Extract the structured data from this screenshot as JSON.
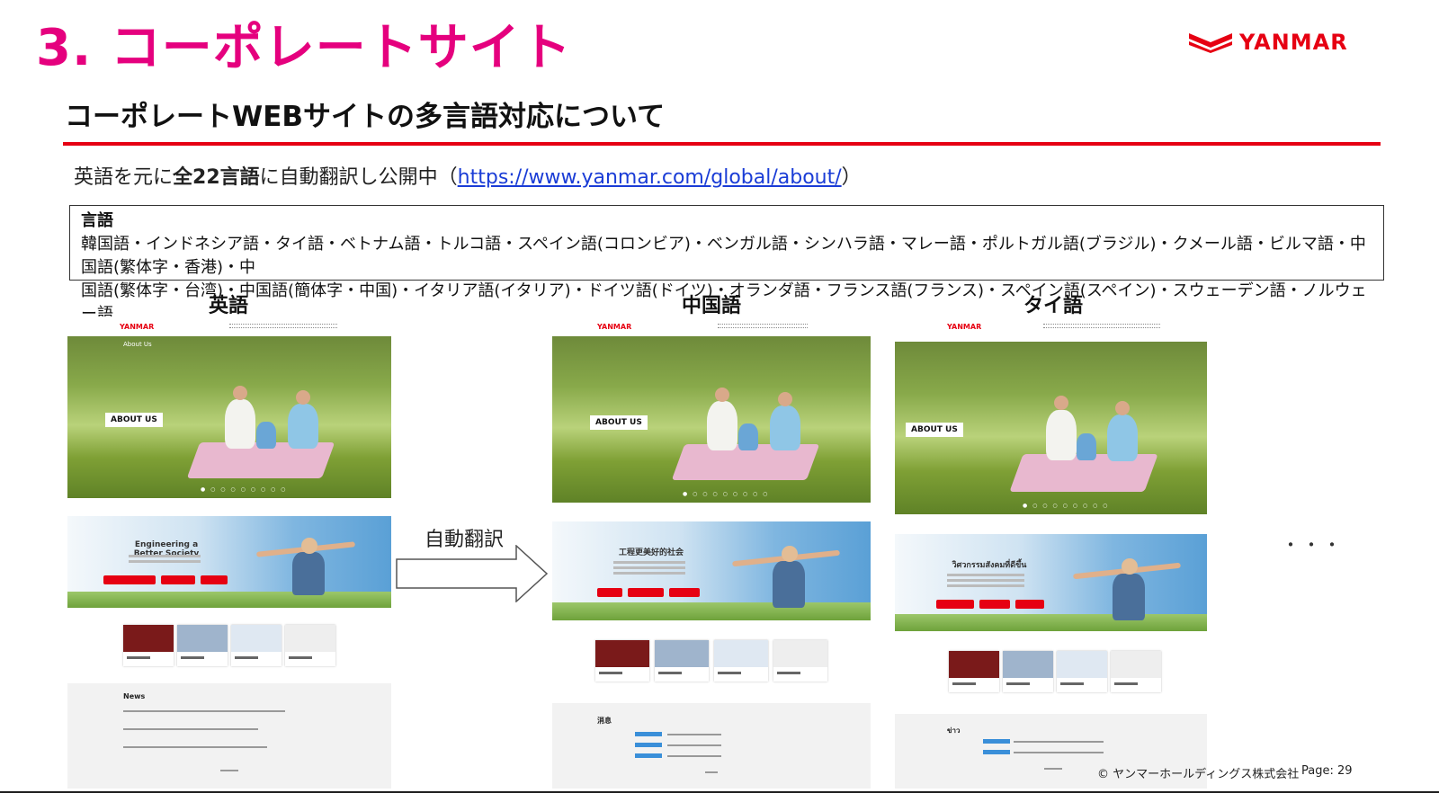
{
  "slide": {
    "title": "3. コーポレートサイト",
    "subtitle": "コーポレートWEBサイトの多言語対応について",
    "intro_prefix": "英語を元に",
    "intro_bold": "全22言語",
    "intro_mid": "に自動翻訳し公開中（",
    "intro_link": "https://www.yanmar.com/global/about/",
    "intro_suffix": "）",
    "lang_heading": "言語",
    "lang_list_1": "韓国語・インドネシア語・タイ語・ベトナム語・トルコ語・スペイン語(コロンビア)・ベンガル語・シンハラ語・マレー語・ポルトガル語(ブラジル)・クメール語・ビルマ語・中国語(繁体字・香港)・中",
    "lang_list_2": "国語(繁体字・台湾)・中国語(簡体字・中国)・イタリア語(イタリア)・ドイツ語(ドイツ)・オランダ語・フランス語(フランス)・スペイン語(スペイン)・スウェーデン語・ノルウェー語",
    "col_english": "英語",
    "col_chinese": "中国語",
    "col_thai": "タイ語",
    "auto_translate": "自動翻訳",
    "ellipsis": "・・・",
    "logo_text": "YANMAR",
    "copyright": "© ヤンマーホールディングス株式会社",
    "page": "Page: 29"
  },
  "mock_sites": {
    "logo": "YANMAR",
    "en": {
      "hero_badge": "ABOUT US",
      "hero_title": "About Us",
      "section_heading": "Engineering a Better Society",
      "news_heading": "News"
    },
    "zh": {
      "hero_badge": "ABOUT US",
      "section_heading": "工程更美好的社会",
      "news_heading": "消息"
    },
    "th": {
      "hero_badge": "ABOUT US",
      "section_heading": "วิศวกรรมสังคมที่ดีขึ้น",
      "news_heading": "ข่าว"
    }
  },
  "colors": {
    "title_magenta": "#e5007e",
    "brand_red": "#e60012",
    "link_blue": "#1a3cd6"
  }
}
